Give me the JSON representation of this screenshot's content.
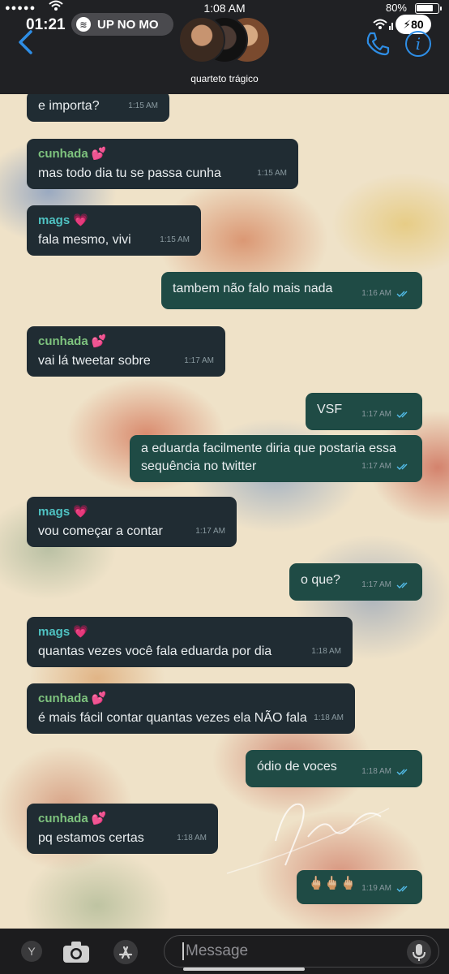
{
  "status": {
    "time": "1:08 AM",
    "battery_pct": "80%",
    "overlay_time": "01:21",
    "now_playing": "UP NO MO",
    "overlay_signal": "5",
    "overlay_battery": "80"
  },
  "header": {
    "group_name": "quarteto trágico"
  },
  "messages": [
    {
      "direction": "in",
      "sender": "",
      "text": "e importa?",
      "time": "1:15 AM"
    },
    {
      "direction": "in",
      "sender": "cunhada 💕",
      "text": "mas todo dia tu se passa cunha",
      "time": "1:15 AM"
    },
    {
      "direction": "in",
      "sender": "mags 💗",
      "text": "fala mesmo, vivi",
      "time": "1:15 AM"
    },
    {
      "direction": "out",
      "sender": "",
      "text": "tambem não falo mais nada",
      "time": "1:16 AM"
    },
    {
      "direction": "in",
      "sender": "cunhada 💕",
      "text": "vai lá tweetar sobre",
      "time": "1:17 AM"
    },
    {
      "direction": "out",
      "sender": "",
      "text": "VSF",
      "time": "1:17 AM"
    },
    {
      "direction": "out",
      "sender": "",
      "text": "a eduarda facilmente diria que postaria essa sequência no twitter",
      "time": "1:17 AM"
    },
    {
      "direction": "in",
      "sender": "mags 💗",
      "text": "vou começar a contar",
      "time": "1:17 AM"
    },
    {
      "direction": "out",
      "sender": "",
      "text": "o que?",
      "time": "1:17 AM"
    },
    {
      "direction": "in",
      "sender": "mags 💗",
      "text": "quantas vezes você fala eduarda por dia",
      "time": "1:18 AM"
    },
    {
      "direction": "in",
      "sender": "cunhada 💕",
      "text": "é mais fácil contar quantas vezes ela NÃO fala",
      "time": "1:18 AM"
    },
    {
      "direction": "out",
      "sender": "",
      "text": "ódio de voces",
      "time": "1:18 AM"
    },
    {
      "direction": "in",
      "sender": "cunhada 💕",
      "text": "pq estamos certas",
      "time": "1:18 AM"
    },
    {
      "direction": "out",
      "sender": "",
      "text": "🖕🏼🖕🏼🖕🏼",
      "time": "1:19 AM"
    }
  ],
  "composer": {
    "placeholder": "Message",
    "avatar_letter": "Y"
  },
  "colors": {
    "incoming": "#202c33",
    "outgoing": "#1f4b45",
    "accent": "#2e8ee6"
  }
}
